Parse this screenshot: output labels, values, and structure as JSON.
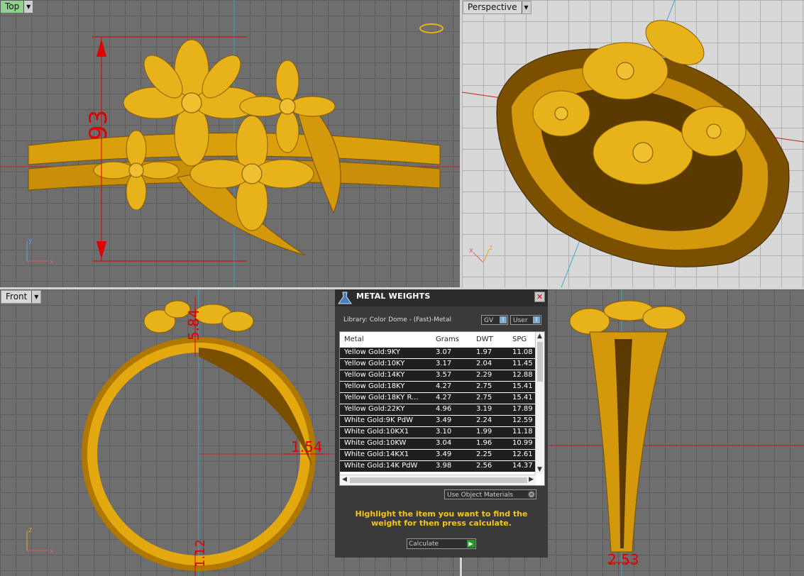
{
  "viewports": {
    "top": {
      "label": "Top",
      "dim_height": "93"
    },
    "perspective": {
      "label": "Perspective"
    },
    "front": {
      "label": "Front",
      "dim_top": "5.84",
      "dim_side": "1.54",
      "dim_bottom": "1.12"
    },
    "right": {
      "dim_bottom": "2.53"
    }
  },
  "axes": {
    "x": "x",
    "y": "y",
    "z": "z"
  },
  "metal_weights": {
    "title": "METAL WEIGHTS",
    "library": "Library: Color Dome - (Fast)-Metal",
    "gv_label": "GV",
    "user_label": "User",
    "columns": [
      "Metal",
      "Grams",
      "DWT",
      "SPG"
    ],
    "rows": [
      [
        "Yellow Gold:9KY",
        "3.07",
        "1.97",
        "11.08"
      ],
      [
        "Yellow Gold:10KY",
        "3.17",
        "2.04",
        "11.45"
      ],
      [
        "Yellow Gold:14KY",
        "3.57",
        "2.29",
        "12.88"
      ],
      [
        "Yellow Gold:18KY",
        "4.27",
        "2.75",
        "15.41"
      ],
      [
        "Yellow Gold:18KY R...",
        "4.27",
        "2.75",
        "15.41"
      ],
      [
        "Yellow Gold:22KY",
        "4.96",
        "3.19",
        "17.89"
      ],
      [
        "White Gold:9K PdW",
        "3.49",
        "2.24",
        "12.59"
      ],
      [
        "White Gold:10KX1",
        "3.10",
        "1.99",
        "11.18"
      ],
      [
        "White Gold:10KW",
        "3.04",
        "1.96",
        "10.99"
      ],
      [
        "White Gold:14KX1",
        "3.49",
        "2.25",
        "12.61"
      ],
      [
        "White Gold:14K PdW",
        "3.98",
        "2.56",
        "14.37"
      ]
    ],
    "use_object_materials": "Use Object Materials",
    "message": "Highlight the item you want to find the weight for then press calculate.",
    "calculate": "Calculate"
  },
  "colors": {
    "gold": "#e3a90f",
    "dimension": "#e00000",
    "highlight": "#f5c518"
  }
}
